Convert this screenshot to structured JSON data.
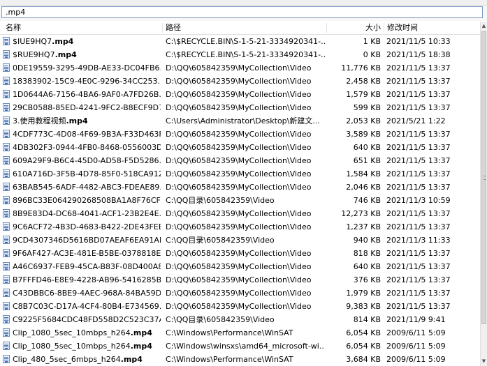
{
  "search": {
    "value": ".mp4"
  },
  "columns": {
    "name": "名称",
    "path": "路径",
    "size": "大小",
    "modified": "修改时间"
  },
  "rows": [
    {
      "name_base": "$IUE9HQ7",
      "name_ext": ".mp4",
      "path": "C:\\$RECYCLE.BIN\\S-1-5-21-3334920341-...",
      "size": "1 KB",
      "modified": "2021/11/5 10:33"
    },
    {
      "name_base": "$RUE9HQ7",
      "name_ext": ".mp4",
      "path": "C:\\$RECYCLE.BIN\\S-1-5-21-3334920341-...",
      "size": "0 KB",
      "modified": "2021/11/5 18:38"
    },
    {
      "name_base": "0DE19559-3295-49DB-AE33-DC04FB6...",
      "name_ext": "",
      "path": "D:\\QQ\\605842359\\MyCollection\\Video",
      "size": "11,776 KB",
      "modified": "2021/11/5 13:37"
    },
    {
      "name_base": "18383902-15C9-4E0C-9296-34CC253...",
      "name_ext": "",
      "path": "D:\\QQ\\605842359\\MyCollection\\Video",
      "size": "2,458 KB",
      "modified": "2021/11/5 13:37"
    },
    {
      "name_base": "1D0644A6-7156-4BA6-9AF0-A7FD26B...",
      "name_ext": "",
      "path": "D:\\QQ\\605842359\\MyCollection\\Video",
      "size": "1,579 KB",
      "modified": "2021/11/5 13:37"
    },
    {
      "name_base": "29CB0588-85ED-4241-9FC2-B8ECF9D7...",
      "name_ext": "",
      "path": "D:\\QQ\\605842359\\MyCollection\\Video",
      "size": "599 KB",
      "modified": "2021/11/5 13:37"
    },
    {
      "name_base": "3.使用教程视频",
      "name_ext": ".mp4",
      "path": "C:\\Users\\Administrator\\Desktop\\新建文...",
      "size": "2,053 KB",
      "modified": "2021/5/21 1:22"
    },
    {
      "name_base": "4CDF773C-4D08-4F69-9B3A-F33D463F...",
      "name_ext": "",
      "path": "D:\\QQ\\605842359\\MyCollection\\Video",
      "size": "3,589 KB",
      "modified": "2021/11/5 13:37"
    },
    {
      "name_base": "4DB302F3-0944-4FB0-8468-0556003D...",
      "name_ext": "",
      "path": "D:\\QQ\\605842359\\MyCollection\\Video",
      "size": "640 KB",
      "modified": "2021/11/5 13:37"
    },
    {
      "name_base": "609A29F9-B6C4-45D0-AD58-F5D5286...",
      "name_ext": "",
      "path": "D:\\QQ\\605842359\\MyCollection\\Video",
      "size": "651 KB",
      "modified": "2021/11/5 13:37"
    },
    {
      "name_base": "610A716D-3F5B-4D78-85F0-518CA912...",
      "name_ext": "",
      "path": "D:\\QQ\\605842359\\MyCollection\\Video",
      "size": "1,584 KB",
      "modified": "2021/11/5 13:37"
    },
    {
      "name_base": "63BAB545-6ADF-4482-ABC3-FDEAE89...",
      "name_ext": "",
      "path": "D:\\QQ\\605842359\\MyCollection\\Video",
      "size": "2,046 KB",
      "modified": "2021/11/5 13:37"
    },
    {
      "name_base": "896BC33E064290268508BA1A8F76CFC...",
      "name_ext": "",
      "path": "C:\\QQ目录\\605842359\\Video",
      "size": "746 KB",
      "modified": "2021/11/3 10:59"
    },
    {
      "name_base": "8B9E83D4-DC68-4041-ACF1-23B2E4E...",
      "name_ext": "",
      "path": "D:\\QQ\\605842359\\MyCollection\\Video",
      "size": "12,273 KB",
      "modified": "2021/11/5 13:37"
    },
    {
      "name_base": "9C6ACF72-4B3D-4683-B422-2DE43FEE...",
      "name_ext": "",
      "path": "D:\\QQ\\605842359\\MyCollection\\Video",
      "size": "1,237 KB",
      "modified": "2021/11/5 13:37"
    },
    {
      "name_base": "9CD4307346D5616BD07AEAF6EA91AF...",
      "name_ext": "",
      "path": "C:\\QQ目录\\605842359\\Video",
      "size": "940 KB",
      "modified": "2021/11/3 11:33"
    },
    {
      "name_base": "9F6AF427-AC3E-481E-B5BE-0378818E...",
      "name_ext": "",
      "path": "D:\\QQ\\605842359\\MyCollection\\Video",
      "size": "818 KB",
      "modified": "2021/11/5 13:37"
    },
    {
      "name_base": "A46C6937-FEB9-45CA-B83F-08D400A8...",
      "name_ext": "",
      "path": "D:\\QQ\\605842359\\MyCollection\\Video",
      "size": "640 KB",
      "modified": "2021/11/5 13:37"
    },
    {
      "name_base": "B7FFFD46-E8E9-4228-AB96-5416285B...",
      "name_ext": "",
      "path": "D:\\QQ\\605842359\\MyCollection\\Video",
      "size": "376 KB",
      "modified": "2021/11/5 13:37"
    },
    {
      "name_base": "C43DBBC6-8BE9-4AEC-968A-84BA59D...",
      "name_ext": "",
      "path": "D:\\QQ\\605842359\\MyCollection\\Video",
      "size": "1,979 KB",
      "modified": "2021/11/5 13:37"
    },
    {
      "name_base": "C8B7C03C-D17A-4CF4-80B4-E734569...",
      "name_ext": "",
      "path": "D:\\QQ\\605842359\\MyCollection\\Video",
      "size": "9,383 KB",
      "modified": "2021/11/5 13:37"
    },
    {
      "name_base": "C9225F5684CDC48FD558D2C523C37A...",
      "name_ext": "",
      "path": "C:\\QQ目录\\605842359\\Video",
      "size": "814 KB",
      "modified": "2021/11/9 9:41"
    },
    {
      "name_base": "Clip_1080_5sec_10mbps_h264",
      "name_ext": ".mp4",
      "path": "C:\\Windows\\Performance\\WinSAT",
      "size": "6,054 KB",
      "modified": "2009/6/11 5:09"
    },
    {
      "name_base": "Clip_1080_5sec_10mbps_h264",
      "name_ext": ".mp4",
      "path": "C:\\Windows\\winsxs\\amd64_microsoft-wi...",
      "size": "6,054 KB",
      "modified": "2009/6/11 5:09"
    },
    {
      "name_base": "Clip_480_5sec_6mbps_h264",
      "name_ext": ".mp4",
      "path": "C:\\Windows\\Performance\\WinSAT",
      "size": "3,684 KB",
      "modified": "2009/6/11 5:09"
    }
  ]
}
